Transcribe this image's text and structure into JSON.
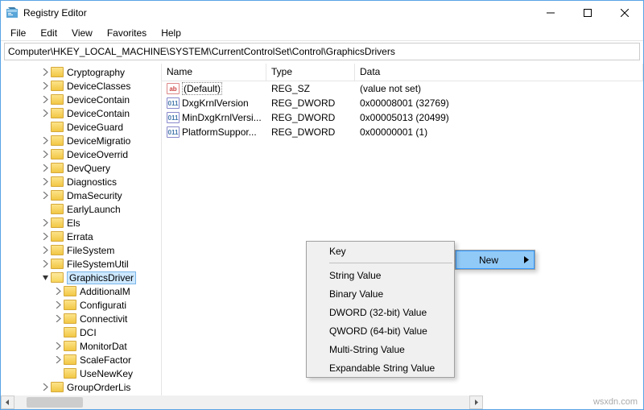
{
  "window": {
    "title": "Registry Editor"
  },
  "menu": {
    "file": "File",
    "edit": "Edit",
    "view": "View",
    "favorites": "Favorites",
    "help": "Help"
  },
  "address": "Computer\\HKEY_LOCAL_MACHINE\\SYSTEM\\CurrentControlSet\\Control\\GraphicsDrivers",
  "tree": [
    {
      "label": "Cryptography",
      "indent": 3,
      "expander": "right",
      "open": false
    },
    {
      "label": "DeviceClasses",
      "indent": 3,
      "expander": "right",
      "open": false
    },
    {
      "label": "DeviceContain",
      "indent": 3,
      "expander": "right",
      "open": false
    },
    {
      "label": "DeviceContain",
      "indent": 3,
      "expander": "right",
      "open": false
    },
    {
      "label": "DeviceGuard",
      "indent": 3,
      "expander": "",
      "open": false
    },
    {
      "label": "DeviceMigratio",
      "indent": 3,
      "expander": "right",
      "open": false
    },
    {
      "label": "DeviceOverrid",
      "indent": 3,
      "expander": "right",
      "open": false
    },
    {
      "label": "DevQuery",
      "indent": 3,
      "expander": "right",
      "open": false
    },
    {
      "label": "Diagnostics",
      "indent": 3,
      "expander": "right",
      "open": false
    },
    {
      "label": "DmaSecurity",
      "indent": 3,
      "expander": "right",
      "open": false
    },
    {
      "label": "EarlyLaunch",
      "indent": 3,
      "expander": "",
      "open": false
    },
    {
      "label": "Els",
      "indent": 3,
      "expander": "right",
      "open": false
    },
    {
      "label": "Errata",
      "indent": 3,
      "expander": "right",
      "open": false
    },
    {
      "label": "FileSystem",
      "indent": 3,
      "expander": "right",
      "open": false
    },
    {
      "label": "FileSystemUtil",
      "indent": 3,
      "expander": "right",
      "open": false
    },
    {
      "label": "GraphicsDriver",
      "indent": 3,
      "expander": "down",
      "open": true,
      "selected": true
    },
    {
      "label": "AdditionalM",
      "indent": 4,
      "expander": "right",
      "open": false
    },
    {
      "label": "Configurati",
      "indent": 4,
      "expander": "right",
      "open": false
    },
    {
      "label": "Connectivit",
      "indent": 4,
      "expander": "right",
      "open": false
    },
    {
      "label": "DCI",
      "indent": 4,
      "expander": "",
      "open": false
    },
    {
      "label": "MonitorDat",
      "indent": 4,
      "expander": "right",
      "open": false
    },
    {
      "label": "ScaleFactor",
      "indent": 4,
      "expander": "right",
      "open": false
    },
    {
      "label": "UseNewKey",
      "indent": 4,
      "expander": "",
      "open": false
    },
    {
      "label": "GroupOrderLis",
      "indent": 3,
      "expander": "right",
      "open": false
    }
  ],
  "columns": {
    "name": "Name",
    "type": "Type",
    "data": "Data"
  },
  "rows": [
    {
      "icon": "sz",
      "name": "(Default)",
      "type": "REG_SZ",
      "data": "(value not set)"
    },
    {
      "icon": "dw",
      "name": "DxgKrnlVersion",
      "type": "REG_DWORD",
      "data": "0x00008001 (32769)"
    },
    {
      "icon": "dw",
      "name": "MinDxgKrnlVersi...",
      "type": "REG_DWORD",
      "data": "0x00005013 (20499)"
    },
    {
      "icon": "dw",
      "name": "PlatformSuppor...",
      "type": "REG_DWORD",
      "data": "0x00000001 (1)"
    }
  ],
  "context_main": {
    "new": "New"
  },
  "context_sub": {
    "key": "Key",
    "string": "String Value",
    "binary": "Binary Value",
    "dword": "DWORD (32-bit) Value",
    "qword": "QWORD (64-bit) Value",
    "multi": "Multi-String Value",
    "expand": "Expandable String Value"
  },
  "watermark": "wsxdn.com"
}
